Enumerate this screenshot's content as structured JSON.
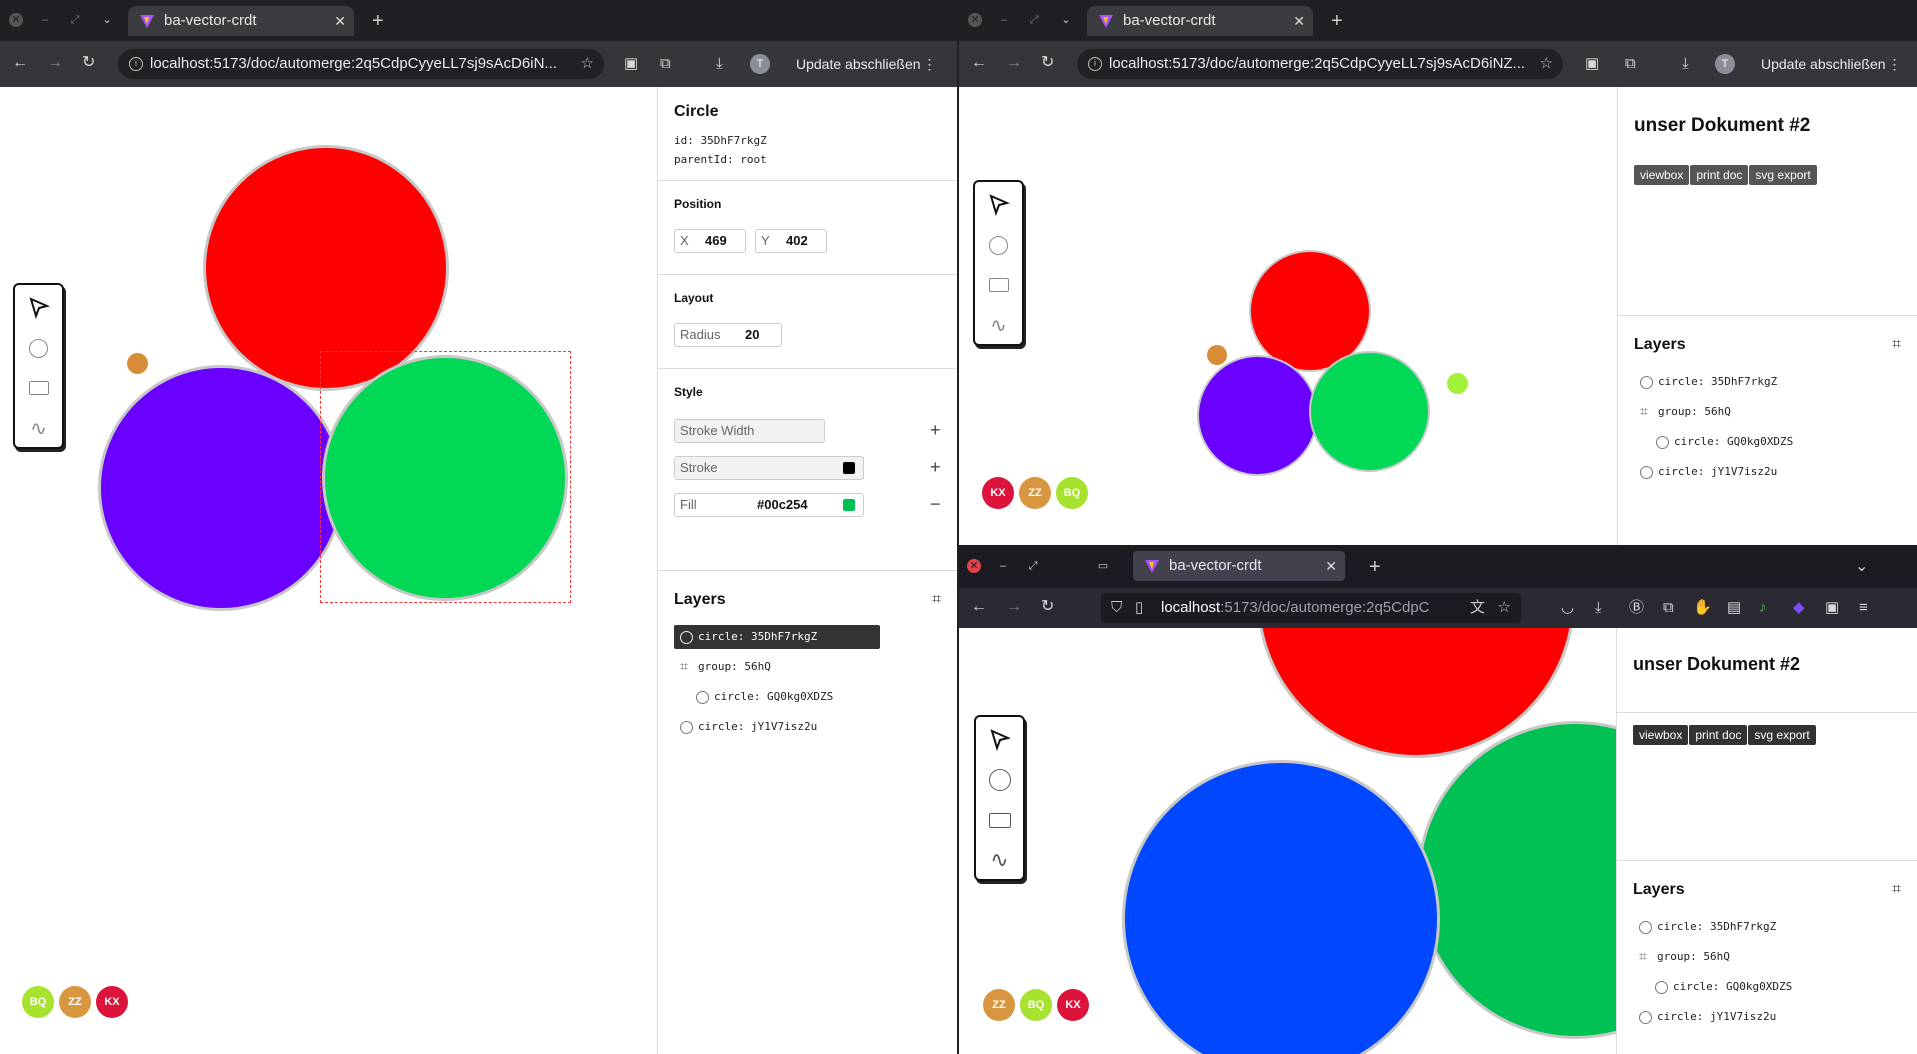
{
  "browser": {
    "tab_title": "ba-vector-crdt",
    "new_tab": "+",
    "close_tab": "✕",
    "url_main": "localhost:5173/doc/automerge:2q5CdpCyyeLL7sj9sAcD6iN...",
    "url_right": "localhost:5173/doc/automerge:2q5CdpCyyeLL7sj9sAcD6iNZ...",
    "url_firefox_host": "localhost",
    "url_firefox_path": ":5173/doc/automerge:2q5CdpC",
    "update_label": "Update abschließen",
    "profile_initial": "T"
  },
  "inspector": {
    "type": "Circle",
    "id_line": "id: 35DhF7rkgZ",
    "parent_line": "parentId: root",
    "position_label": "Position",
    "x_label": "X",
    "x_value": "469",
    "y_label": "Y",
    "y_value": "402",
    "layout_label": "Layout",
    "radius_label": "Radius",
    "radius_value": "20",
    "style_label": "Style",
    "stroke_width_label": "Stroke Width",
    "stroke_label": "Stroke",
    "stroke_color": "#000000",
    "fill_label": "Fill",
    "fill_value": "#00c254",
    "fill_color": "#00c254"
  },
  "doc": {
    "title": "unser Dokument #2",
    "buttons": [
      "viewbox",
      "print doc",
      "svg export"
    ]
  },
  "layers": {
    "title": "Layers",
    "items": [
      "circle: 35DhF7rkgZ",
      "group: 56hQ",
      "circle: GQ0kg0XDZS",
      "circle: jY1V7isz2u"
    ]
  },
  "avatars": {
    "bq": "BQ",
    "zz": "ZZ",
    "kx": "KX"
  },
  "colors": {
    "red": "#ff0000",
    "purple": "#6a00ff",
    "green": "#00d856",
    "blue": "#0048ff",
    "orange": "#d98c38",
    "lime": "#a3f23a",
    "avatar_kx": "#dc143c",
    "avatar_zz": "#d99640",
    "avatar_bq": "#a6e22e"
  }
}
